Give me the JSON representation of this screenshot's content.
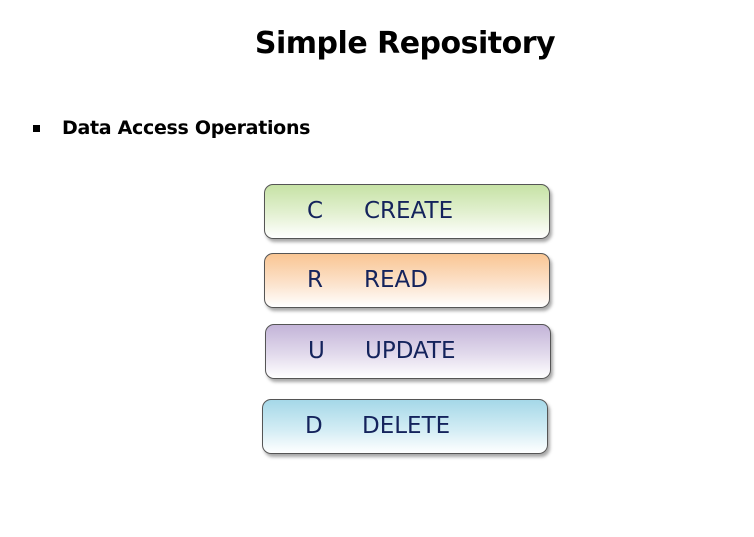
{
  "slide": {
    "title": "Simple Repository",
    "bullet": "Data Access Operations"
  },
  "operations": [
    {
      "letter": "C",
      "word": "CREATE",
      "color": "#c6e2a5"
    },
    {
      "letter": "R",
      "word": "READ",
      "color": "#f9c593"
    },
    {
      "letter": "U",
      "word": "UPDATE",
      "color": "#c3b4d8"
    },
    {
      "letter": "D",
      "word": "DELETE",
      "color": "#a5d8e8"
    }
  ]
}
